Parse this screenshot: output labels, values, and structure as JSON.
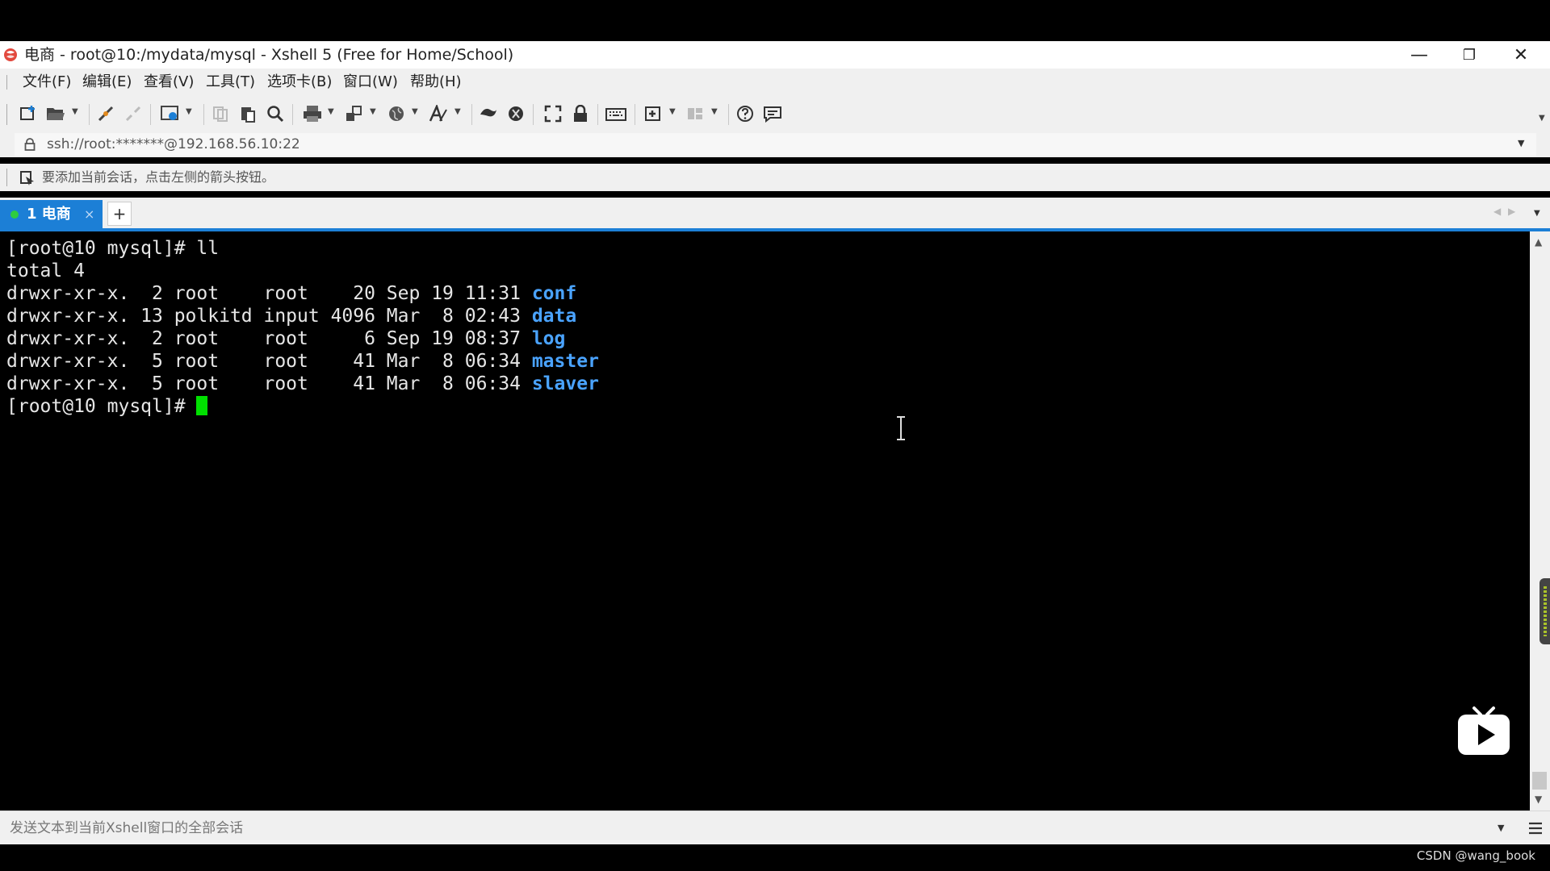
{
  "window": {
    "title": "电商 - root@10:/mydata/mysql - Xshell 5 (Free for Home/School)",
    "minimize": "—",
    "maximize": "❐",
    "close": "✕"
  },
  "menu": [
    {
      "label": "文件(F)"
    },
    {
      "label": "编辑(E)"
    },
    {
      "label": "查看(V)"
    },
    {
      "label": "工具(T)"
    },
    {
      "label": "选项卡(B)"
    },
    {
      "label": "窗口(W)"
    },
    {
      "label": "帮助(H)"
    }
  ],
  "address": {
    "value": "ssh://root:*******@192.168.56.10:22"
  },
  "session_bar": {
    "text": "要添加当前会话，点击左侧的箭头按钮。"
  },
  "tabs": [
    {
      "label": "1 电商",
      "close": "×",
      "active": true
    }
  ],
  "new_tab": "+",
  "terminal": {
    "lines": [
      {
        "text": "[root@10 mysql]# ll"
      },
      {
        "text": "total 4"
      },
      {
        "text": "drwxr-xr-x.  2 root    root    20 Sep 19 11:31 ",
        "dir": "conf"
      },
      {
        "text": "drwxr-xr-x. 13 polkitd input 4096 Mar  8 02:43 ",
        "dir": "data"
      },
      {
        "text": "drwxr-xr-x.  2 root    root     6 Sep 19 08:37 ",
        "dir": "log"
      },
      {
        "text": "drwxr-xr-x.  5 root    root    41 Mar  8 06:34 ",
        "dir": "master"
      },
      {
        "text": "drwxr-xr-x.  5 root    root    41 Mar  8 06:34 ",
        "dir": "slaver"
      },
      {
        "text": "[root@10 mysql]# "
      }
    ],
    "cursor_color": "#00e000",
    "dir_color": "#4aa3ff"
  },
  "send_bar": {
    "placeholder": "发送文本到当前Xshell窗口的全部会话"
  },
  "watermark": "CSDN @wang_book",
  "colors": {
    "accent": "#1c7fd6",
    "terminal_bg": "#000000",
    "chrome_bg": "#f0f0f0"
  },
  "icons": [
    "xshell-app-icon",
    "new-session-icon",
    "open-icon",
    "reconnect-icon",
    "disconnect-icon",
    "properties-icon",
    "copy-icon",
    "paste-icon",
    "find-icon",
    "print-icon",
    "transfer-icon",
    "globe-icon",
    "font-icon",
    "xftp-icon",
    "xmanager-icon",
    "fullscreen-icon",
    "lock-icon",
    "keyboard-icon",
    "new-tab-icon",
    "layout-icon",
    "help-icon",
    "chat-icon",
    "bilibili-tv-icon",
    "ibeam-cursor-icon"
  ]
}
